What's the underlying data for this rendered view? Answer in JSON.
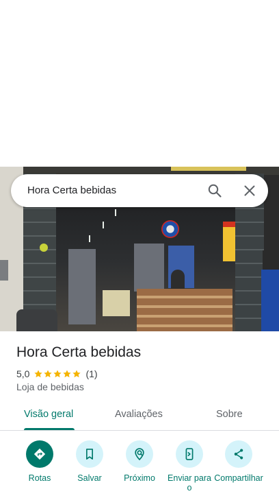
{
  "search": {
    "query": "Hora Certa bebidas",
    "search_icon": "search-icon",
    "close_icon": "close-icon"
  },
  "place": {
    "title": "Hora Certa bebidas",
    "rating": "5,0",
    "stars": 5,
    "review_count": "(1)",
    "category": "Loja de bebidas"
  },
  "tabs": [
    {
      "label": "Visão geral",
      "active": true
    },
    {
      "label": "Avaliações",
      "active": false
    },
    {
      "label": "Sobre",
      "active": false
    }
  ],
  "actions": [
    {
      "label": "Rotas",
      "icon": "directions-icon"
    },
    {
      "label": "Salvar",
      "icon": "bookmark-icon"
    },
    {
      "label": "Próximo",
      "icon": "nearby-icon"
    },
    {
      "label": "Enviar para o",
      "icon": "send-to-phone-icon"
    },
    {
      "label": "Compartilhar",
      "icon": "share-icon"
    }
  ],
  "colors": {
    "accent": "#00796b",
    "action_bg": "#d4f3fa",
    "star": "#f5b400"
  }
}
